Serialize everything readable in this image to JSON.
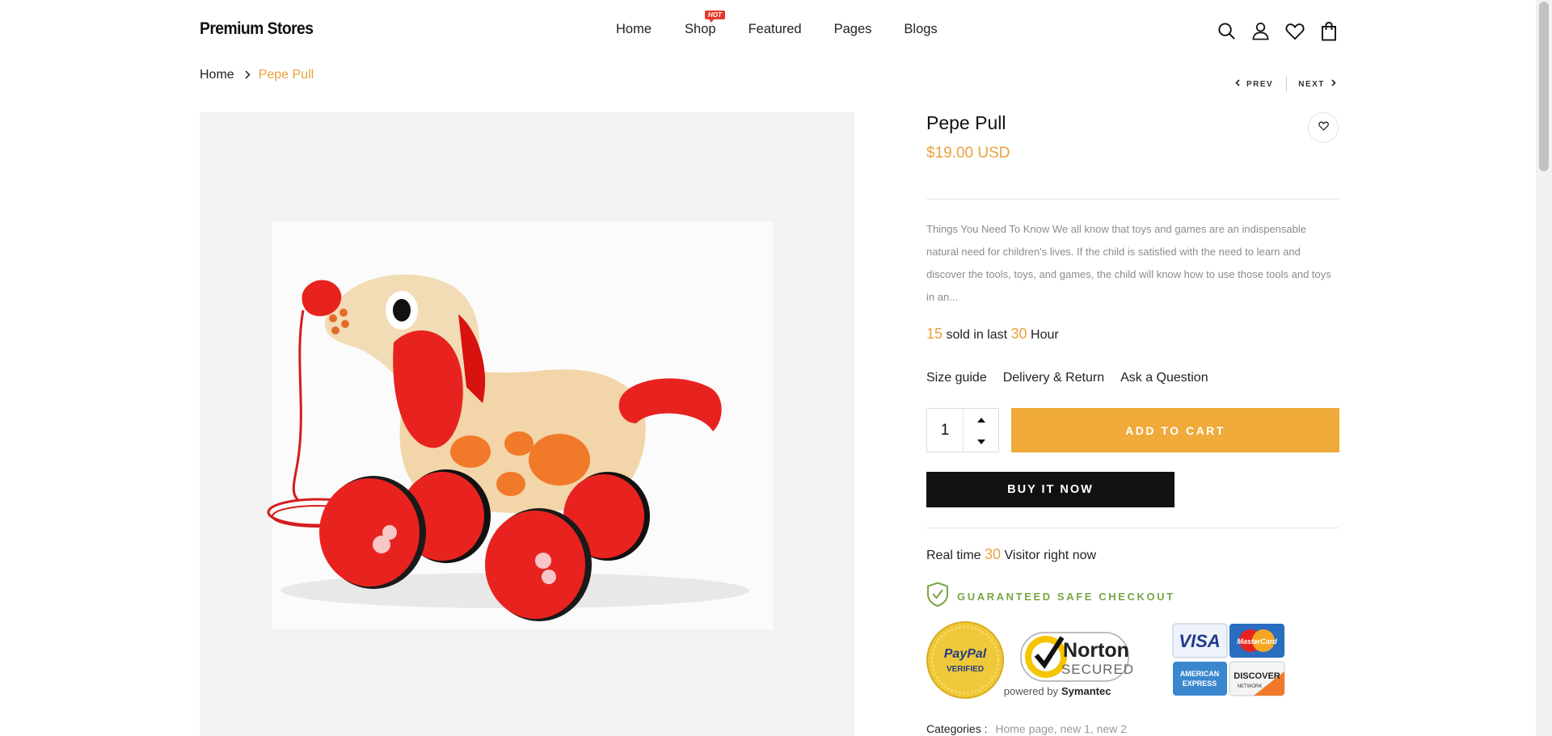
{
  "header": {
    "logo": "Premium Stores",
    "nav": [
      {
        "label": "Home"
      },
      {
        "label": "Shop",
        "badge": "HOT"
      },
      {
        "label": "Featured"
      },
      {
        "label": "Pages"
      },
      {
        "label": "Blogs"
      }
    ],
    "icons": [
      "search-icon",
      "account-icon",
      "wishlist-icon",
      "cart-icon"
    ]
  },
  "breadcrumb": {
    "home": "Home",
    "current": "Pepe Pull"
  },
  "pager": {
    "prev": "PREV",
    "next": "NEXT"
  },
  "product": {
    "title": "Pepe Pull",
    "price": "$19.00 USD",
    "description": "Things You Need To Know We all know that toys and games are an indispensable natural need for children's lives. If the child is satisfied with the need to learn and discover the tools, toys, and games, the child will know how to use those tools and toys in an...",
    "sold": {
      "count": "15",
      "middle": "sold in last",
      "hours": "30",
      "suffix": "Hour"
    },
    "links": [
      "Size guide",
      "Delivery & Return",
      "Ask a Question"
    ],
    "quantity": "1",
    "add_to_cart": "ADD TO CART",
    "buy_now": "BUY IT NOW",
    "visitors": {
      "prefix": "Real time",
      "count": "30",
      "suffix": "Visitor right now"
    },
    "safe_checkout": "GUARANTEED SAFE CHECKOUT",
    "badges": {
      "paypal_line1": "PayPal",
      "paypal_line2": "VERIFIED",
      "norton_line1": "Norton",
      "norton_line2": "SECURED",
      "norton_powered": "powered by",
      "norton_brand": "Symantec",
      "visa": "VISA",
      "mastercard": "MasterCard",
      "amex_line1": "AMERICAN",
      "amex_line2": "EXPRESS",
      "discover": "DISCOVER",
      "discover_sub": "NETWORK"
    },
    "categories_label": "Categories :",
    "categories": "Home page, new 1, new 2"
  },
  "colors": {
    "accent": "#e9a23b",
    "cart_button": "#efaa3a",
    "buy_button": "#111111",
    "safe_green": "#7aa546",
    "hot_badge": "#e53b2c"
  }
}
